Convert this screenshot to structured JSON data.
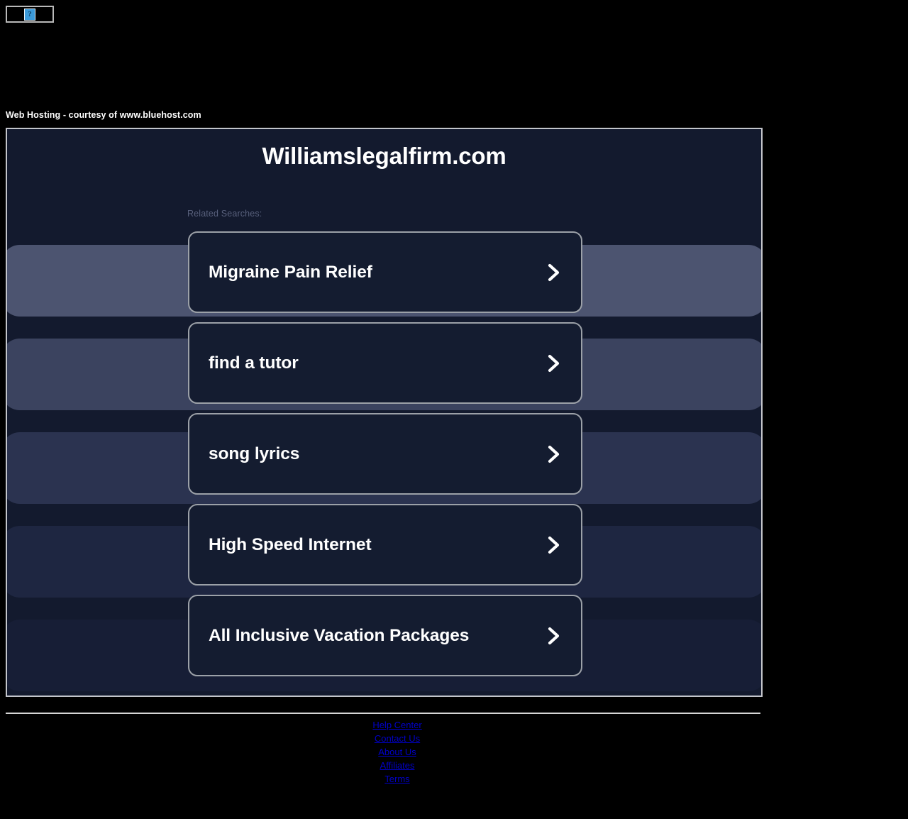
{
  "broken_image": {
    "icon": "broken-image-question-icon",
    "glyph": "?"
  },
  "host_caption": "Web Hosting - courtesy of www.bluehost.com",
  "park_page": {
    "domain_title": "Williamslegalfirm.com",
    "related_label": "Related Searches:",
    "chevron_icon": "chevron-right-icon",
    "related_searches": [
      {
        "label": "Migraine Pain Relief"
      },
      {
        "label": "find a tutor"
      },
      {
        "label": "song lyrics"
      },
      {
        "label": "High Speed Internet"
      },
      {
        "label": "All Inclusive Vacation Packages"
      }
    ]
  },
  "footer": {
    "links": [
      {
        "label": "Help Center"
      },
      {
        "label": "Contact Us"
      },
      {
        "label": "About Us"
      },
      {
        "label": "Affiliates"
      },
      {
        "label": "Terms"
      }
    ]
  },
  "colors": {
    "page_background": "#000000",
    "container_background": "#131a2e",
    "card_background": "#141c30",
    "card_border": "#9ca1a8",
    "container_border": "#c3c5cb",
    "title_text": "#ffffff",
    "muted_text": "#58607c",
    "link_blue": "#0000c8"
  }
}
